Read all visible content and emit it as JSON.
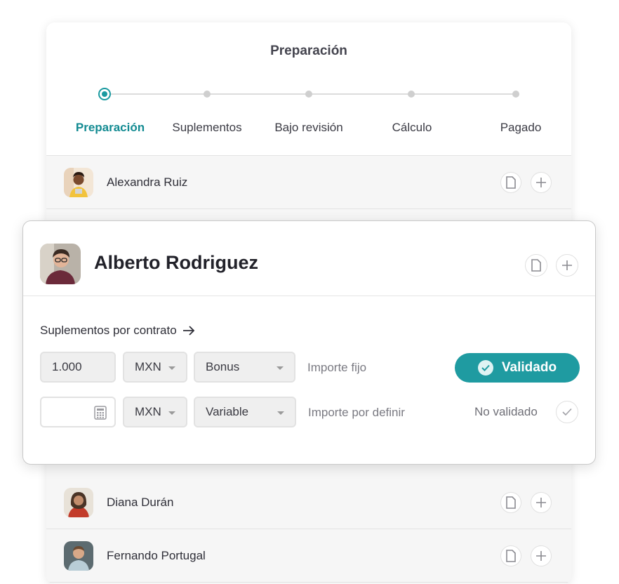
{
  "stepper": {
    "title": "Preparación",
    "steps": [
      {
        "label": "Preparación",
        "active": true
      },
      {
        "label": "Suplementos",
        "active": false
      },
      {
        "label": "Bajo revisión",
        "active": false
      },
      {
        "label": "Cálculo",
        "active": false
      },
      {
        "label": "Pagado",
        "active": false
      }
    ]
  },
  "people": [
    {
      "name": "Alexandra Ruiz"
    },
    {
      "name": "Diana Durán"
    },
    {
      "name": "Fernando Portugal"
    }
  ],
  "detail": {
    "name": "Alberto Rodriguez",
    "section_link": "Suplementos por contrato",
    "rows": [
      {
        "amount": "1.000",
        "currency": "MXN",
        "type": "Bonus",
        "hint": "Importe fijo",
        "status": "Validado"
      },
      {
        "amount": "",
        "currency": "MXN",
        "type": "Variable",
        "hint": "Importe por definir",
        "status": "No validado"
      }
    ]
  },
  "colors": {
    "accent": "#1f9ba1",
    "accent_text": "#138b92",
    "card_bg": "#f6f6f6"
  },
  "icons": [
    "document-icon",
    "plus-icon",
    "arrow-right-icon",
    "calculator-icon",
    "chevron-down-icon",
    "check-icon"
  ]
}
